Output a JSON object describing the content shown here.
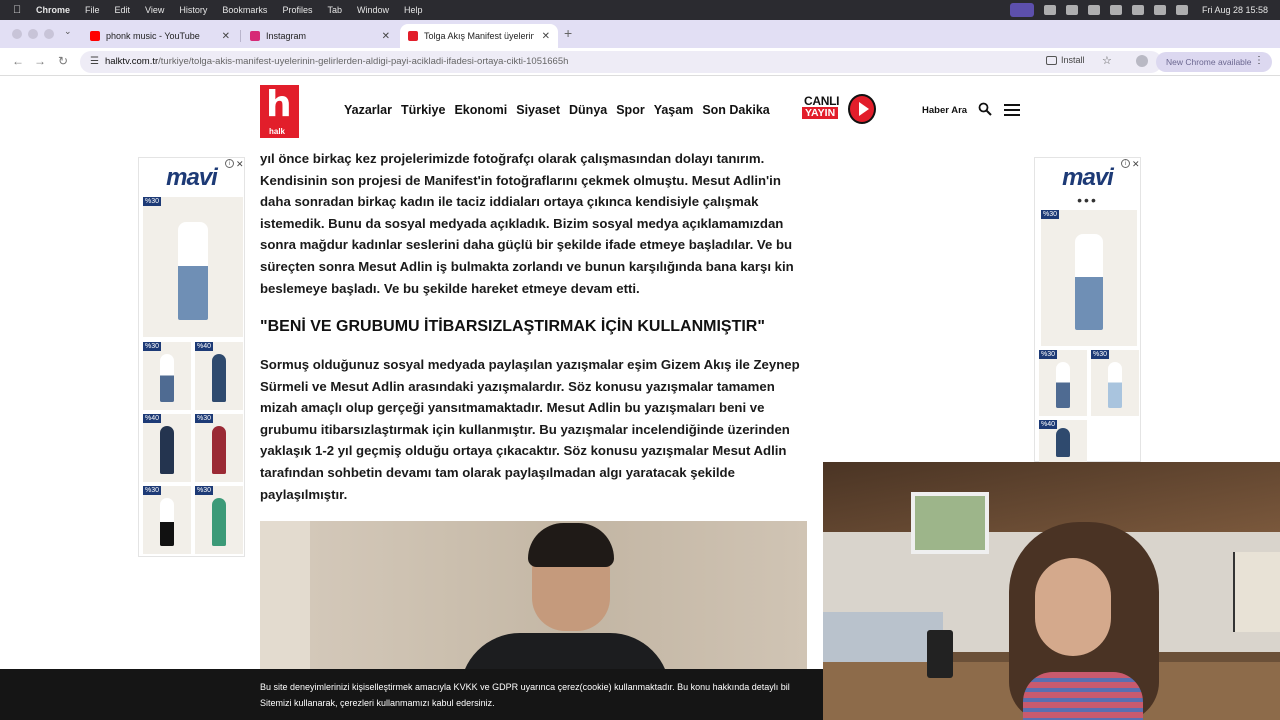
{
  "menubar": {
    "app": "Chrome",
    "items": [
      "File",
      "Edit",
      "View",
      "History",
      "Bookmarks",
      "Profiles",
      "Tab",
      "Window",
      "Help"
    ],
    "clock": "Fri Aug 28  15:58"
  },
  "tabs": [
    {
      "title": "phonk music - YouTube",
      "favicon_color": "#ff0000"
    },
    {
      "title": "Instagram",
      "favicon_color": "#d62976"
    },
    {
      "title": "Tolga Akış Manifest üyelerinin",
      "favicon_color": "#e21e2b"
    }
  ],
  "address": {
    "host": "halktv.com.tr",
    "path": "/turkiye/tolga-akis-manifest-uyelerinin-gelirlerden-aldigi-payi-acikladi-ifadesi-ortaya-cikti-1051665h",
    "install_label": "Install",
    "update_label": "New Chrome available"
  },
  "site": {
    "logo_text": "h",
    "logo_sub": "halk",
    "nav": [
      "Yazarlar",
      "Türkiye",
      "Ekonomi",
      "Siyaset",
      "Dünya",
      "Spor",
      "Yaşam",
      "Son Dakika"
    ],
    "live_top": "CANLI",
    "live_bottom": "YAYIN",
    "search_label": "Haber Ara"
  },
  "article": {
    "para1": "yıl önce birkaç kez projelerimizde fotoğrafçı olarak çalışmasından dolayı tanırım. Kendisinin son projesi de Manifest'in fotoğraflarını çekmek olmuştu. Mesut Adlin'in daha sonradan birkaç kadın ile taciz iddiaları ortaya çıkınca kendisiyle çalışmak istemedik. Bunu da sosyal medyada açıkladık. Bizim sosyal medya açıklamamızdan sonra mağdur kadınlar seslerini daha güçlü bir şekilde ifade etmeye başladılar. Ve bu süreçten sonra Mesut Adlin iş bulmakta zorlandı ve bunun karşılığında bana karşı kin beslemeye başladı. Ve bu şekilde hareket etmeye devam etti.",
    "subheading": "\"BENİ VE GRUBUMU İTİBARSIZLAŞTIRMAK İÇİN KULLANMIŞTIR\"",
    "para2": "Sormuş olduğunuz sosyal medyada paylaşılan yazışmalar eşim Gizem Akış ile Zeynep Sürmeli ve Mesut Adlin arasındaki yazışmalardır. Söz konusu yazışmalar tamamen mizah amaçlı olup gerçeği yansıtmamaktadır. Mesut Adlin bu yazışmaları beni ve grubumu itibarsızlaştırmak için kullanmıştır. Bu yazışmalar incelendiğinde üzerinden yaklaşık 1-2 yıl geçmiş olduğu ortaya çıkacaktır. Söz konusu yazışmalar Mesut Adlin tarafından sohbetin devamı tam olarak paylaşılmadan algı yaratacak şekilde paylaşılmıştır."
  },
  "ads": {
    "brand": "mavi",
    "left_badges": [
      "%30",
      "%30",
      "%40",
      "%40",
      "%30",
      "%30",
      "%30"
    ],
    "right_badges": [
      "%30",
      "%30",
      "%30",
      "%40"
    ],
    "colors": {
      "brand": "#1d3a76",
      "accent": "#e21e2b"
    }
  },
  "cookie": {
    "line1": "Bu site deneyimlerinizi kişiselleştirmek amacıyla KVKK ve GDPR uyarınca çerez(cookie) kullanmaktadır. Bu konu hakkında detaylı bil",
    "line2": "Sitemizi kullanarak, çerezleri kullanmamızı kabul edersiniz."
  }
}
